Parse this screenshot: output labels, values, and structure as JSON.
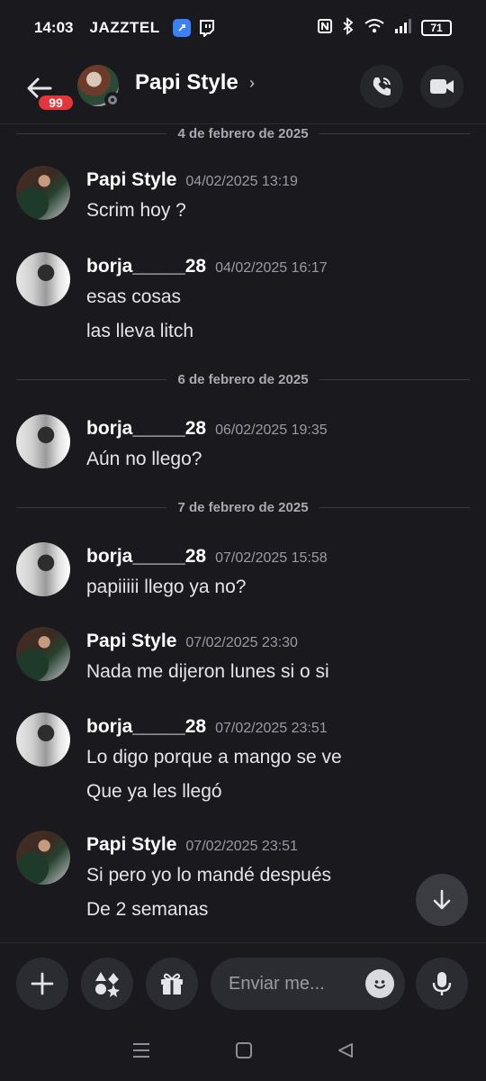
{
  "status_bar": {
    "time": "14:03",
    "carrier": "JAZZTEL",
    "battery": "71"
  },
  "header": {
    "unread_badge": "99",
    "title": "Papi Style",
    "chevron": "›"
  },
  "messages": [
    {
      "type": "divider",
      "label": "4 de febrero de 2025"
    },
    {
      "type": "message",
      "author": "Papi Style",
      "avatar": "papi",
      "timestamp": "04/02/2025 13:19",
      "lines": [
        "Scrim hoy ?"
      ]
    },
    {
      "type": "message",
      "author": "borja_____28",
      "avatar": "borja",
      "timestamp": "04/02/2025 16:17",
      "lines": [
        "esas cosas",
        "las lleva litch"
      ]
    },
    {
      "type": "divider",
      "label": "6 de febrero de 2025"
    },
    {
      "type": "message",
      "author": "borja_____28",
      "avatar": "borja",
      "timestamp": "06/02/2025 19:35",
      "lines": [
        "Aún no llego?"
      ]
    },
    {
      "type": "divider",
      "label": "7 de febrero de 2025"
    },
    {
      "type": "message",
      "author": "borja_____28",
      "avatar": "borja",
      "timestamp": "07/02/2025 15:58",
      "lines": [
        "papiiiii llego ya no?"
      ]
    },
    {
      "type": "message",
      "author": "Papi Style",
      "avatar": "papi",
      "timestamp": "07/02/2025 23:30",
      "lines": [
        "Nada me dijeron lunes si o si"
      ]
    },
    {
      "type": "message",
      "author": "borja_____28",
      "avatar": "borja",
      "timestamp": "07/02/2025 23:51",
      "lines": [
        "Lo digo porque a mango se ve",
        "Que ya les llegó"
      ]
    },
    {
      "type": "message",
      "author": "Papi Style",
      "avatar": "papi",
      "timestamp": "07/02/2025 23:51",
      "lines": [
        "Si pero yo lo mandé después",
        "De 2 semanas"
      ]
    }
  ],
  "composer": {
    "placeholder": "Enviar me..."
  },
  "colors": {
    "background": "#1a1a1e",
    "badge": "#e5353b",
    "button": "#2b2c31"
  }
}
